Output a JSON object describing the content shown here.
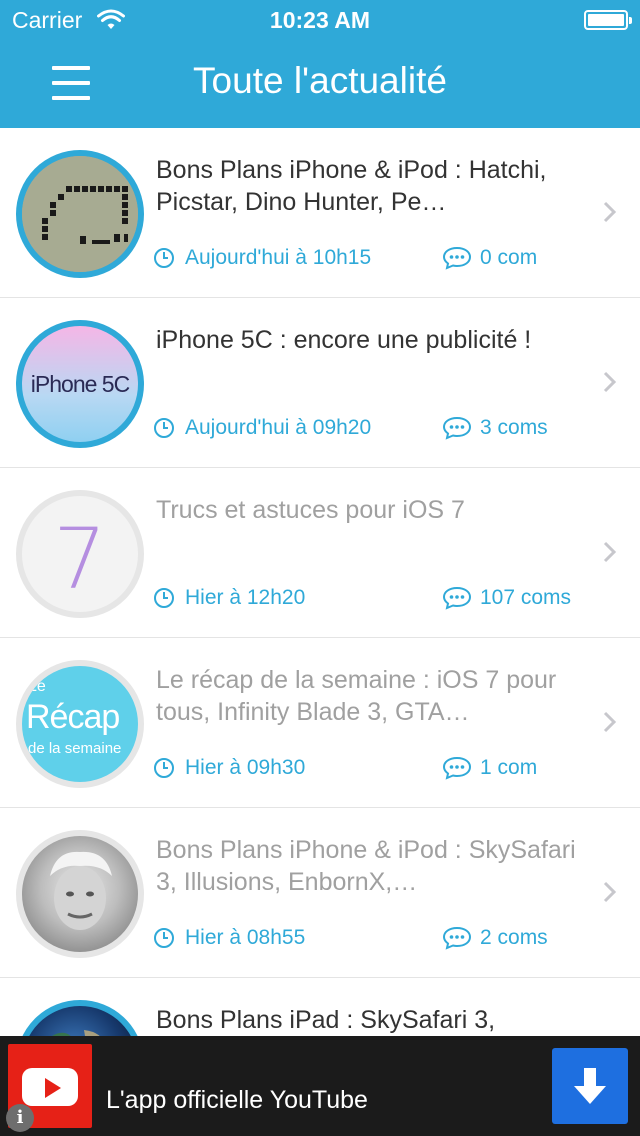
{
  "status_bar": {
    "carrier": "Carrier",
    "time": "10:23 AM"
  },
  "header": {
    "title": "Toute l'actualité",
    "menu_icon": "hamburger-menu-icon"
  },
  "articles": [
    {
      "title": "Bons Plans iPhone & iPod : Hatchi, Picstar, Dino Hunter, Pe…",
      "time": "Aujourd'hui à 10h15",
      "comments": "0 com",
      "read": false,
      "thumb": "hatchi-pixel-art"
    },
    {
      "title": "iPhone 5C : encore une publicité !",
      "time": "Aujourd'hui à 09h20",
      "comments": "3 coms",
      "read": false,
      "thumb": "iphone-5c-logo",
      "thumb_text": "iPhone 5C"
    },
    {
      "title": "Trucs et astuces pour iOS 7",
      "time": "Hier à 12h20",
      "comments": "107 coms",
      "read": true,
      "thumb": "ios7-logo",
      "thumb_text": "7"
    },
    {
      "title": "Le récap de la semaine : iOS 7 pour tous, Infinity Blade 3, GTA…",
      "time": "Hier à 09h30",
      "comments": "1 com",
      "read": true,
      "thumb": "recap-logo",
      "thumb_text": [
        "Le",
        "Récap",
        "de la semaine"
      ]
    },
    {
      "title": "Bons Plans iPhone & iPod : SkySafari 3, Illusions, EnbornX,…",
      "time": "Hier à 08h55",
      "comments": "2 coms",
      "read": true,
      "thumb": "einstein-portrait"
    },
    {
      "title": "Bons Plans iPad : SkySafari 3,",
      "time": "",
      "comments": "",
      "read": false,
      "thumb": "earth-globe"
    }
  ],
  "ad": {
    "text": "L'app officielle YouTube",
    "logo": "youtube-logo",
    "info_icon": "info-icon",
    "info_glyph": "i",
    "download_icon": "download-arrow-icon"
  },
  "colors": {
    "accent": "#2fa9d8",
    "ad_background": "#1b1b1b",
    "youtube_red": "#e62117",
    "download_blue": "#1e6fe0"
  }
}
